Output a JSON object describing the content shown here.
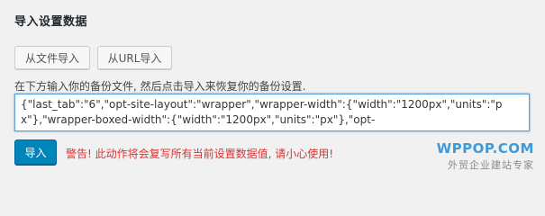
{
  "section": {
    "title": "导入设置数据"
  },
  "buttons": {
    "from_file": "从文件导入",
    "from_url": "从URL导入",
    "import": "导入"
  },
  "hint": "在下方输入你的备份文件, 然后点击导入来恢复你的备份设置.",
  "backup_textarea": {
    "value": "{\"last_tab\":\"6\",\"opt-site-layout\":\"wrapper\",\"wrapper-width\":{\"width\":\"1200px\",\"units\":\"px\"},\"wrapper-boxed-width\":{\"width\":\"1200px\",\"units\":\"px\"},\"opt-"
  },
  "warning": "警告! 此动作将会复写所有当前设置数据值, 请小心使用!",
  "watermark": {
    "logo": "WPPOP.COM",
    "tagline": "外贸企业建站专家"
  },
  "colors": {
    "primary_button": "#0085ba",
    "warning_text": "#dc3232",
    "focus_border": "#5b9dd9",
    "watermark_blue": "#3d9bd9"
  }
}
